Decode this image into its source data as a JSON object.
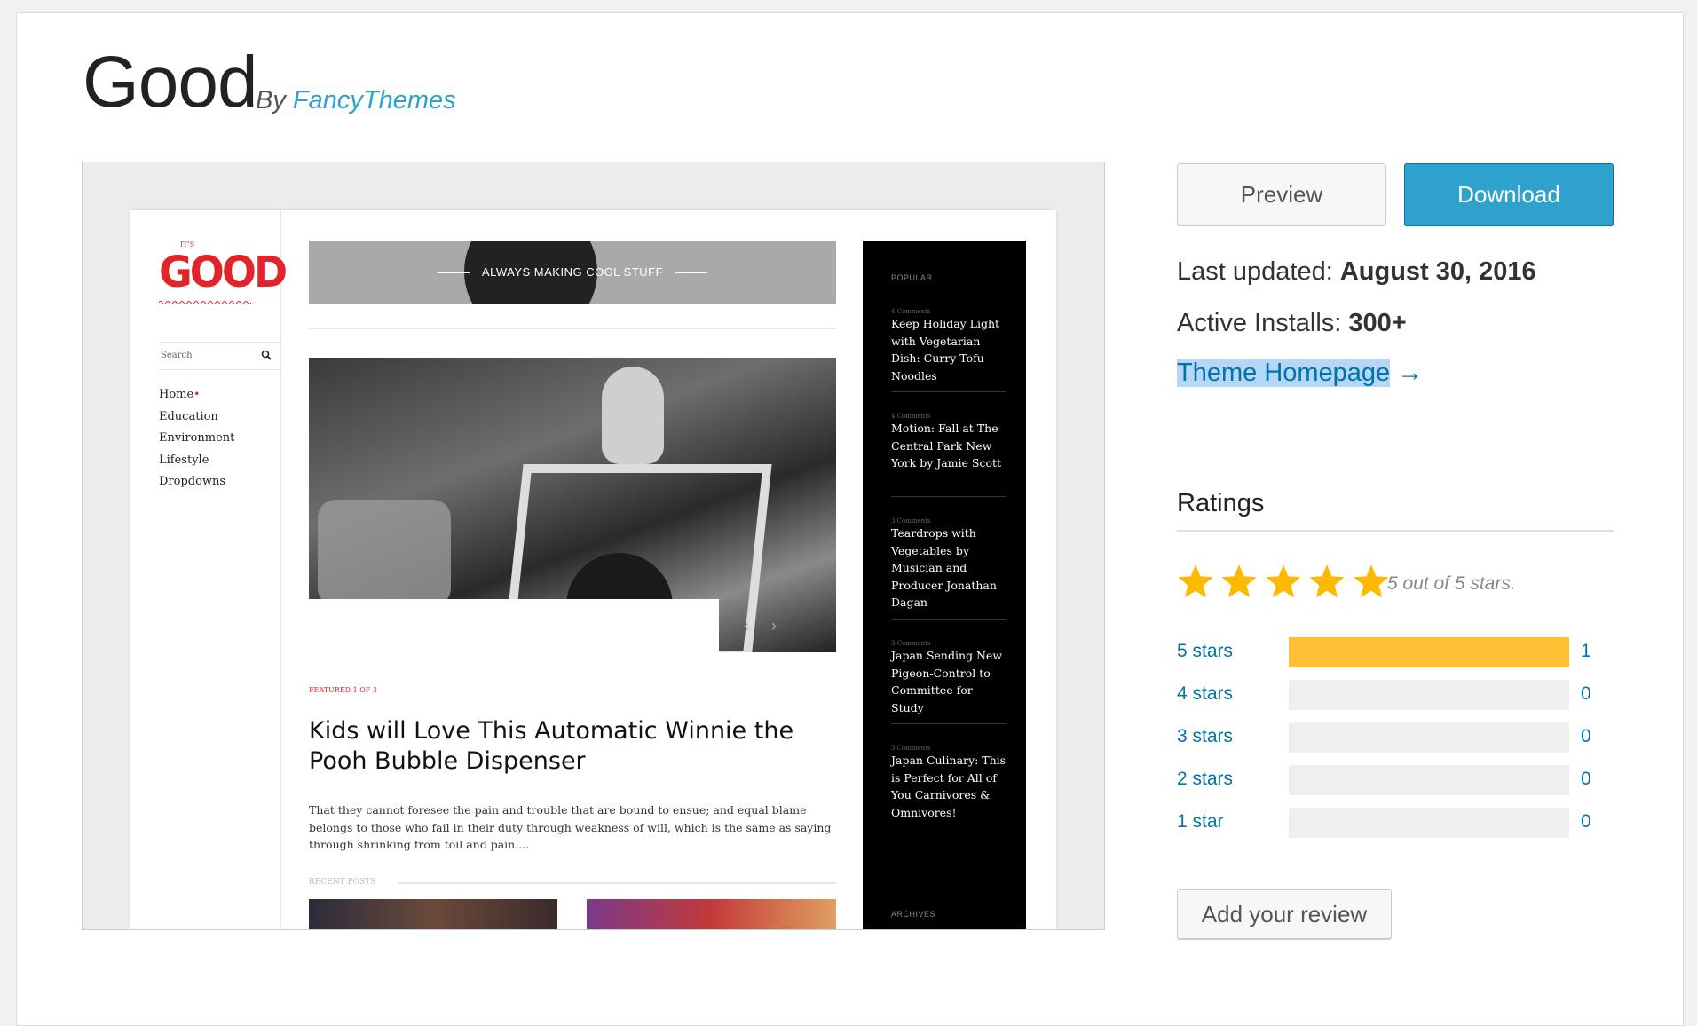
{
  "theme": {
    "name": "Good",
    "by_prefix": "By",
    "author": "FancyThemes"
  },
  "preview_site": {
    "logo_small": "IT'S",
    "logo": "GOOD",
    "search_placeholder": "Search",
    "nav": [
      "Home",
      "Education",
      "Environment",
      "Lifestyle",
      "Dropdowns"
    ],
    "banner_text": "ALWAYS MAKING COOL STUFF",
    "featured_label": "FEATURED 1 OF 3",
    "headline": "Kids will Love This Automatic Winnie the Pooh Bubble Dispenser",
    "excerpt": "That they cannot foresee the pain and trouble that are bound to ensue; and equal blame belongs to those who fail in their duty through weakness of will, which is the same as saying through shrinking from toil and pain....",
    "recent_label": "RECENT POSTS",
    "sidebar": {
      "popular_label": "POPULAR",
      "archives_label": "ARCHIVES",
      "items": [
        {
          "comments": "4 Comments",
          "title": "Keep Holiday Light with Vegetarian Dish: Curry Tofu Noodles"
        },
        {
          "comments": "4 Comments",
          "title": "Motion: Fall at The Central Park New York by Jamie Scott"
        },
        {
          "comments": "3 Comments",
          "title": "Teardrops with Vegetables by Musician and Producer Jonathan Dagan"
        },
        {
          "comments": "3 Comments",
          "title": "Japan Sending New Pigeon-Control to Committee for Study"
        },
        {
          "comments": "3 Comments",
          "title": "Japan Culinary: This is Perfect for All of You Carnivores & Omnivores!"
        }
      ]
    }
  },
  "actions": {
    "preview": "Preview",
    "download": "Download",
    "add_review": "Add your review"
  },
  "meta": {
    "last_updated_label": "Last updated:",
    "last_updated_value": "August 30, 2016",
    "active_installs_label": "Active Installs:",
    "active_installs_value": "300+",
    "homepage_link": "Theme Homepage",
    "homepage_arrow": "→"
  },
  "ratings": {
    "heading": "Ratings",
    "summary": "5 out of 5 stars.",
    "star_count": 5,
    "rows": [
      {
        "label": "5 stars",
        "count": "1",
        "fraction": 1.0
      },
      {
        "label": "4 stars",
        "count": "0",
        "fraction": 0
      },
      {
        "label": "3 stars",
        "count": "0",
        "fraction": 0
      },
      {
        "label": "2 stars",
        "count": "0",
        "fraction": 0
      },
      {
        "label": "1 star",
        "count": "0",
        "fraction": 0
      }
    ]
  },
  "colors": {
    "link": "#0073aa",
    "download_button": "#2ea2cc",
    "star": "#ffb900",
    "rating_fill": "#ffbf35"
  }
}
